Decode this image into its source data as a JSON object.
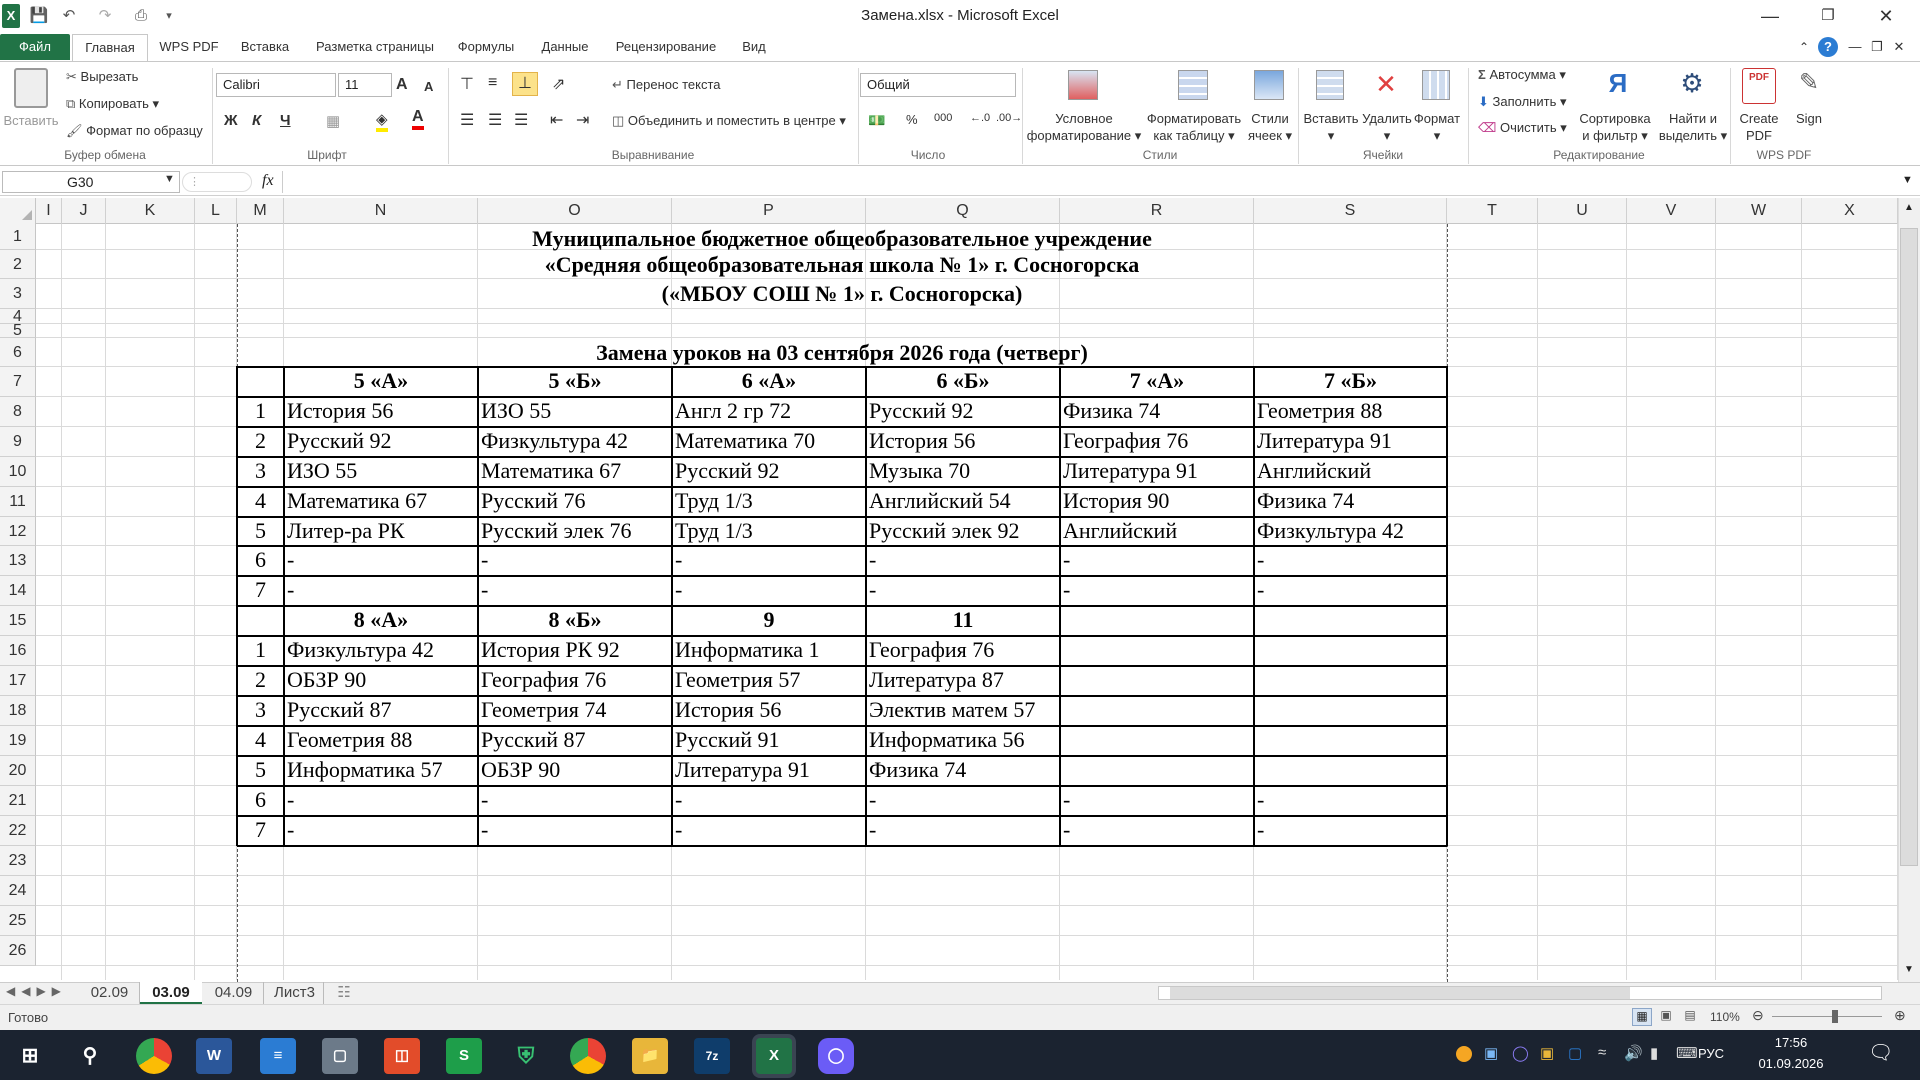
{
  "window": {
    "title": "Замена.xlsx - Microsoft Excel"
  },
  "qat": {
    "save_icon": "save-icon",
    "undo_icon": "undo-icon",
    "redo_icon": "redo-icon",
    "print_icon": "print-icon"
  },
  "tabs": [
    "Файл",
    "Главная",
    "WPS PDF",
    "Вставка",
    "Разметка страницы",
    "Формулы",
    "Данные",
    "Рецензирование",
    "Вид"
  ],
  "ribbon": {
    "clipboard": {
      "paste": "Вставить",
      "cut": "Вырезать",
      "copy": "Копировать",
      "format_painter": "Формат по образцу",
      "label": "Буфер обмена"
    },
    "font": {
      "name": "Calibri",
      "size": "11",
      "bold": "Ж",
      "italic": "К",
      "underline": "Ч",
      "grow": "A",
      "shrink": "A",
      "label": "Шрифт"
    },
    "alignment": {
      "wrap": "Перенос текста",
      "merge": "Объединить и поместить в центре",
      "label": "Выравнивание"
    },
    "number": {
      "format": "Общий",
      "percent": "%",
      "thousands": "000",
      "label": "Число"
    },
    "styles": {
      "conditional": "Условное",
      "conditional2": "форматирование",
      "as_table": "Форматировать",
      "as_table2": "как таблицу",
      "cell_styles": "Стили",
      "cell_styles2": "ячеек",
      "label": "Стили"
    },
    "cells": {
      "insert": "Вставить",
      "delete": "Удалить",
      "format": "Формат",
      "label": "Ячейки"
    },
    "editing": {
      "autosum": "Автосумма",
      "fill": "Заполнить",
      "clear": "Очистить",
      "sort": "Сортировка",
      "sort2": "и фильтр",
      "find": "Найти и",
      "find2": "выделить",
      "label": "Редактирование"
    },
    "wps": {
      "create": "Create",
      "create2": "PDF",
      "sign": "Sign",
      "label": "WPS PDF"
    }
  },
  "formula_bar": {
    "name_box": "G30",
    "fx": "fx",
    "value": ""
  },
  "columns": [
    "I",
    "J",
    "K",
    "L",
    "M",
    "N",
    "O",
    "P",
    "Q",
    "R",
    "S",
    "T",
    "U",
    "V",
    "W",
    "X"
  ],
  "rows": [
    "1",
    "2",
    "3",
    "4",
    "5",
    "6",
    "7",
    "8",
    "9",
    "10",
    "11",
    "12",
    "13",
    "14",
    "15",
    "16",
    "17",
    "18",
    "19",
    "20",
    "21",
    "22",
    "23",
    "24",
    "25",
    "26"
  ],
  "sheet": {
    "header1": "Муниципальное бюджетное общеобразовательное учреждение",
    "header2": "«Средняя общеобразовательная школа № 1» г. Сосногорска",
    "header3": "(«МБОУ СОШ № 1» г. Сосногорска)",
    "heading": "Замена уроков на 03 сентября 2026 года (четверг)",
    "table1": {
      "classes": [
        "5 «А»",
        "5 «Б»",
        "6 «А»",
        "6 «Б»",
        "7 «А»",
        "7 «Б»"
      ],
      "rows": [
        {
          "n": "1",
          "cells": [
            "История 56",
            "ИЗО 55",
            "Англ 2 гр 72",
            "Русский 92",
            "Физика 74",
            "Геометрия 88"
          ]
        },
        {
          "n": "2",
          "cells": [
            "Русский 92",
            "Физкультура 42",
            "Математика 70",
            "История 56",
            "География 76",
            "Литература 91"
          ]
        },
        {
          "n": "3",
          "cells": [
            "ИЗО 55",
            "Математика 67",
            "Русский 92",
            "Музыка 70",
            "Литература 91",
            "Английский"
          ]
        },
        {
          "n": "4",
          "cells": [
            "Математика 67",
            "Русский 76",
            "Труд 1/3",
            "Английский 54",
            "История 90",
            "Физика 74"
          ]
        },
        {
          "n": "5",
          "cells": [
            "Литер-ра РК",
            "Русский элек 76",
            "Труд 1/3",
            "Русский элек 92",
            "Английский",
            "Физкультура 42"
          ]
        },
        {
          "n": "6",
          "cells": [
            "-",
            "-",
            "-",
            "-",
            "-",
            "-"
          ]
        },
        {
          "n": "7",
          "cells": [
            "-",
            "-",
            "-",
            "-",
            "-",
            "-"
          ]
        }
      ]
    },
    "table2": {
      "classes": [
        "8 «А»",
        "8 «Б»",
        "9",
        "11",
        "",
        ""
      ],
      "rows": [
        {
          "n": "1",
          "cells": [
            "Физкультура 42",
            "История РК 92",
            "Информатика 1",
            "География 76",
            "",
            ""
          ]
        },
        {
          "n": "2",
          "cells": [
            "ОБЗР 90",
            "География 76",
            "Геометрия 57",
            "Литература 87",
            "",
            ""
          ]
        },
        {
          "n": "3",
          "cells": [
            "Русский 87",
            "Геометрия 74",
            "История 56",
            "Электив матем 57",
            "",
            ""
          ]
        },
        {
          "n": "4",
          "cells": [
            "Геометрия 88",
            "Русский 87",
            "Русский 91",
            "Информатика 56",
            "",
            ""
          ]
        },
        {
          "n": "5",
          "cells": [
            "Информатика 57",
            "ОБЗР 90",
            "Литература 91",
            "Физика 74",
            "",
            ""
          ]
        },
        {
          "n": "6",
          "cells": [
            "-",
            "-",
            "-",
            "-",
            "-",
            "-"
          ]
        },
        {
          "n": "7",
          "cells": [
            "-",
            "-",
            "-",
            "-",
            "-",
            "-"
          ]
        }
      ]
    }
  },
  "sheet_tabs": [
    "02.09",
    "03.09",
    "04.09",
    "Лист3"
  ],
  "active_sheet": "03.09",
  "status": {
    "ready": "Готово",
    "zoom": "110%"
  },
  "taskbar": {
    "lang": "РУС",
    "time": "17:56",
    "date": "01.09.2026"
  },
  "colors": {
    "excel_green": "#217346",
    "taskbar": "#1b2330"
  }
}
